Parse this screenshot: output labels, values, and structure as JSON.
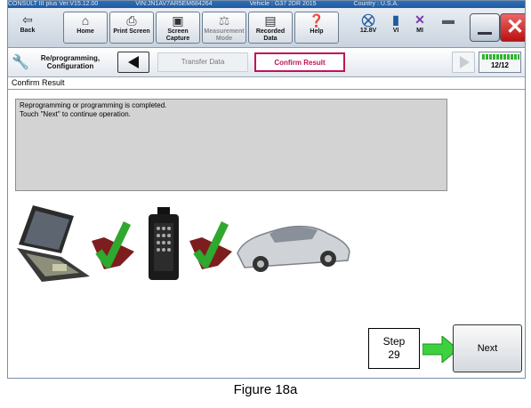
{
  "titlebar": {
    "left": "CONSULT III plus  Ver.V15.12.00",
    "middle": "VIN:JN1AV7AR5EM684264",
    "right": "Vehicle : G37 2DR 2015",
    "country": "Country : U.S.A."
  },
  "toolbar": {
    "back": "Back",
    "home": "Home",
    "print": "Print Screen",
    "capture": "Screen Capture",
    "measurement": "Measurement Mode",
    "recorded": "Recorded Data",
    "help": "Help",
    "voltage": "12.8V",
    "vi": "VI",
    "mi": "MI"
  },
  "nav": {
    "label": "Re/programming, Configuration",
    "step_inactive": "Transfer Data",
    "step_active": "Confirm Result",
    "progress": "12/12",
    "progress_value": 1.0
  },
  "page_title": "Confirm Result",
  "message": [
    "Reprogramming or programming is completed.",
    "Touch \"Next\" to continue operation."
  ],
  "callout": {
    "step_line1": "Step",
    "step_line2": "29"
  },
  "next_button": "Next",
  "caption": "Figure 18a",
  "colors": {
    "active_step": "#c0135a",
    "check": "#2fa82f",
    "arrow": "#3dd13d",
    "panel": "#d3d3d3"
  }
}
